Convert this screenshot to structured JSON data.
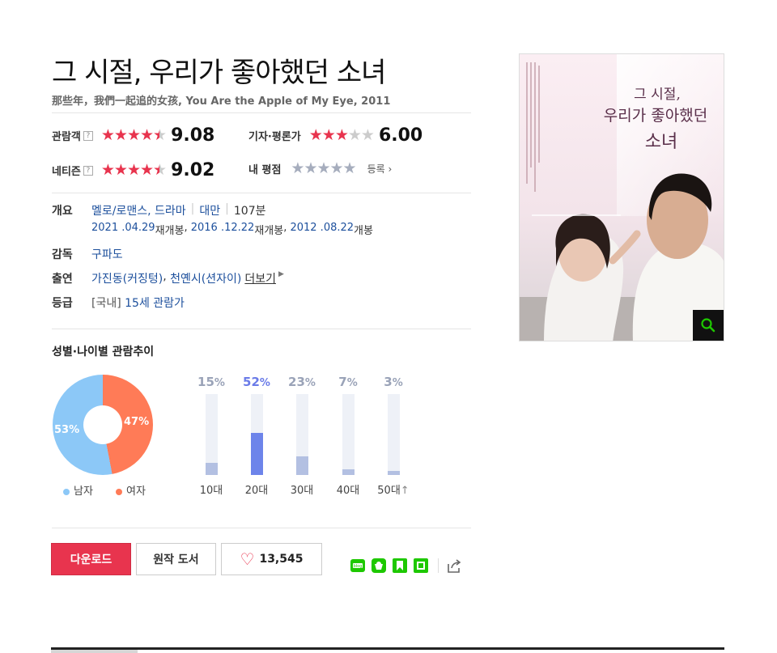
{
  "movie": {
    "title": "그 시절, 우리가 좋아했던 소녀",
    "subtitle": "那些年，我們一起追的女孩, You Are the Apple of My Eye, 2011"
  },
  "ratings": {
    "audience": {
      "label": "관람객",
      "score": "9.08",
      "stars": 4.5
    },
    "critic": {
      "label": "기자·평론가",
      "score": "6.00",
      "stars": 3
    },
    "netizen": {
      "label": "네티즌",
      "score": "9.02",
      "stars": 4.5
    },
    "mine": {
      "label": "내 평점",
      "stars": 0,
      "register": "등록"
    },
    "help_glyph": "?"
  },
  "info": {
    "overview_label": "개요",
    "genre": "멜로/로맨스, 드라마",
    "country": "대만",
    "runtime": "107분",
    "release": [
      {
        "date": "2021 .04.29",
        "type": "재개봉"
      },
      {
        "date": "2016 .12.22",
        "type": "재개봉"
      },
      {
        "date": "2012 .08.22",
        "type": "개봉"
      }
    ],
    "director_label": "감독",
    "director": "구파도",
    "cast_label": "출연",
    "cast": [
      "가진동(커징텅)",
      "천옌시(션자이)"
    ],
    "more": "더보기",
    "grade_label": "등급",
    "grade_prefix": "[국내]",
    "grade": "15세 관람가"
  },
  "trend": {
    "title": "성별·나이별 관람추이",
    "gender": {
      "male": {
        "label": "남자",
        "pct": 53,
        "text": "53%",
        "color": "#8cc8f7"
      },
      "female": {
        "label": "여자",
        "pct": 47,
        "text": "47%",
        "color": "#ff7b57"
      }
    },
    "ages": [
      {
        "label": "10대",
        "num": "15",
        "pct": 15,
        "highlight": false
      },
      {
        "label": "20대",
        "num": "52",
        "pct": 52,
        "highlight": true
      },
      {
        "label": "30대",
        "num": "23",
        "pct": 23,
        "highlight": false
      },
      {
        "label": "40대",
        "num": "7",
        "pct": 7,
        "highlight": false
      },
      {
        "label": "50대",
        "num": "3",
        "pct": 3,
        "highlight": false
      }
    ],
    "pct_sign": "%",
    "up_glyph": "↑"
  },
  "actions": {
    "download": "다운로드",
    "book": "원작 도서",
    "likes": "13,545"
  },
  "poster": {
    "title_line1": "그 시절,",
    "title_line2": "우리가 좋아했던",
    "title_line3": "소녀"
  },
  "colors": {
    "accent": "#e8344e",
    "link": "#1c4f9c",
    "share_green": "#1ec800"
  },
  "icons": [
    "help-icon",
    "star-icon",
    "heart-icon",
    "blog-share-icon",
    "band-share-icon",
    "bookmark-share-icon",
    "memo-share-icon",
    "share-icon",
    "zoom-icon"
  ]
}
